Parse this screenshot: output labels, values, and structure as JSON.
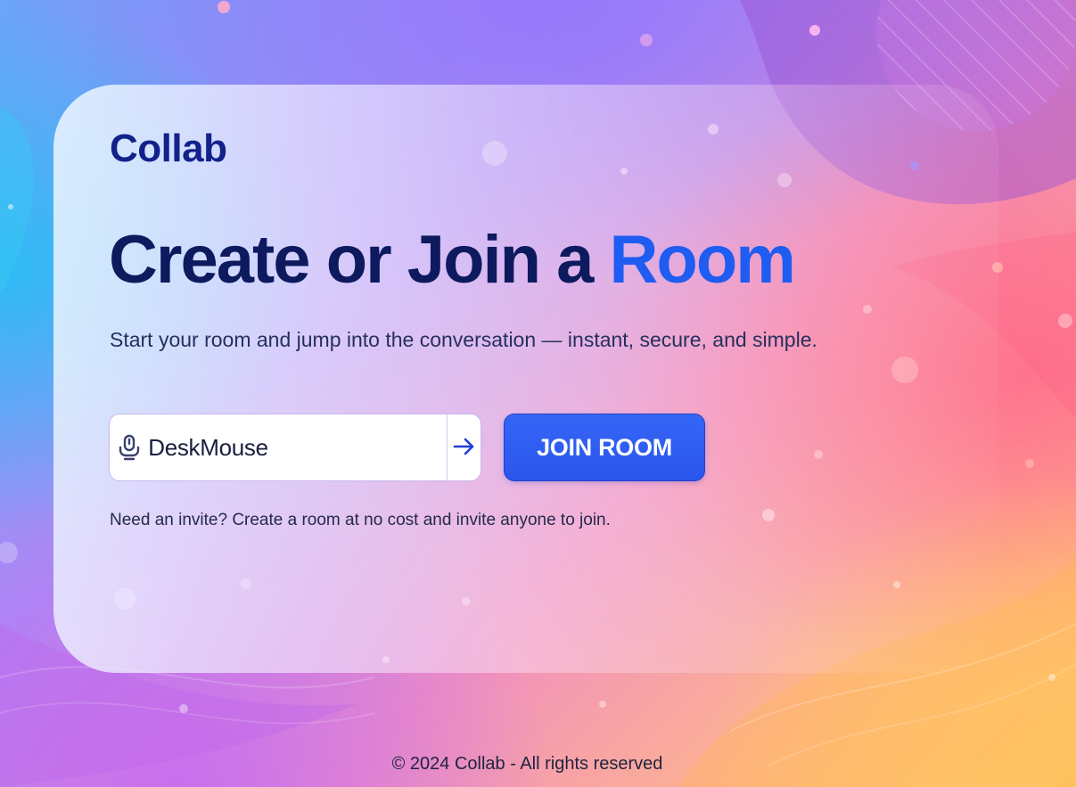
{
  "brand": {
    "name": "Collab"
  },
  "hero": {
    "title_main": "Create or Join a ",
    "title_accent": "Room",
    "subtitle": "Start your room and jump into the conversation — instant, secure, and simple."
  },
  "join_form": {
    "input_icon": "microphone-icon",
    "name_value": "DeskMouse",
    "submit_icon": "arrow-right-icon",
    "join_button_label": "JOIN ROOM"
  },
  "hint": {
    "text": "Need an invite? Create a room at no cost and invite anyone to join."
  },
  "footer": {
    "text": "© 2024 Collab - All rights reserved"
  },
  "colors": {
    "brand_navy": "#12228a",
    "headline_navy": "#0e1a5e",
    "accent_blue": "#1f5cf2",
    "button_blue": "#3566f6"
  }
}
